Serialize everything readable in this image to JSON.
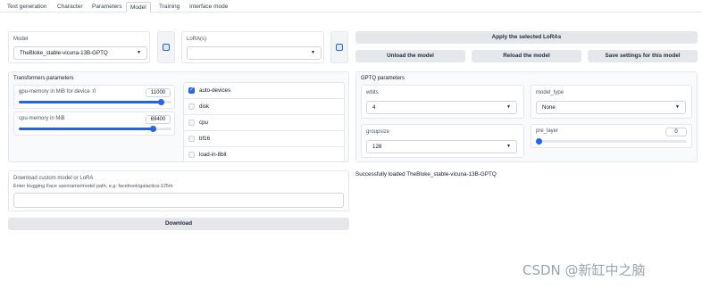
{
  "tabs": [
    "Text generation",
    "Character",
    "Parameters",
    "Model",
    "Training",
    "Interface mode"
  ],
  "model": {
    "label": "Model",
    "value": "TheBloke_stable-vicuna-13B-GPTQ"
  },
  "lora": {
    "label": "LoRA(s)",
    "value": ""
  },
  "buttons": {
    "apply_lora": "Apply the selected LoRAs",
    "unload": "Unload the model",
    "reload": "Reload the model",
    "save_settings": "Save settings for this model",
    "download": "Download"
  },
  "transformers": {
    "title": "Transformers parameters",
    "gpu_memory": {
      "label": "gpu-memory in MiB for device :0",
      "value": "11000",
      "fraction": 0.93
    },
    "cpu_memory": {
      "label": "cpu-memory in MiB",
      "value": "69400",
      "fraction": 0.88
    },
    "options": [
      {
        "label": "auto-devices",
        "checked": true
      },
      {
        "label": "disk",
        "checked": false
      },
      {
        "label": "cpu",
        "checked": false
      },
      {
        "label": "bf16",
        "checked": false
      },
      {
        "label": "load-in-8bit",
        "checked": false
      }
    ]
  },
  "gptq": {
    "title": "GPTQ parameters",
    "wbits": {
      "label": "wbits",
      "value": "4"
    },
    "model_type": {
      "label": "model_type",
      "value": "None"
    },
    "groupsize": {
      "label": "groupsize",
      "value": "128"
    },
    "pre_layer": {
      "label": "pre_layer",
      "value": "0",
      "fraction": 0
    }
  },
  "download": {
    "title": "Download custom model or LoRA",
    "hint": "Enter Hugging Face username/model path, e.g: facebook/galactica-125m",
    "value": ""
  },
  "status": "Successfully loaded TheBloke_stable-vicuna-13B-GPTQ",
  "watermark": "CSDN @新缸中之脑",
  "colors": {
    "accent": "#2563eb",
    "button_bg": "#e5e7eb",
    "border": "#e5e7eb"
  }
}
